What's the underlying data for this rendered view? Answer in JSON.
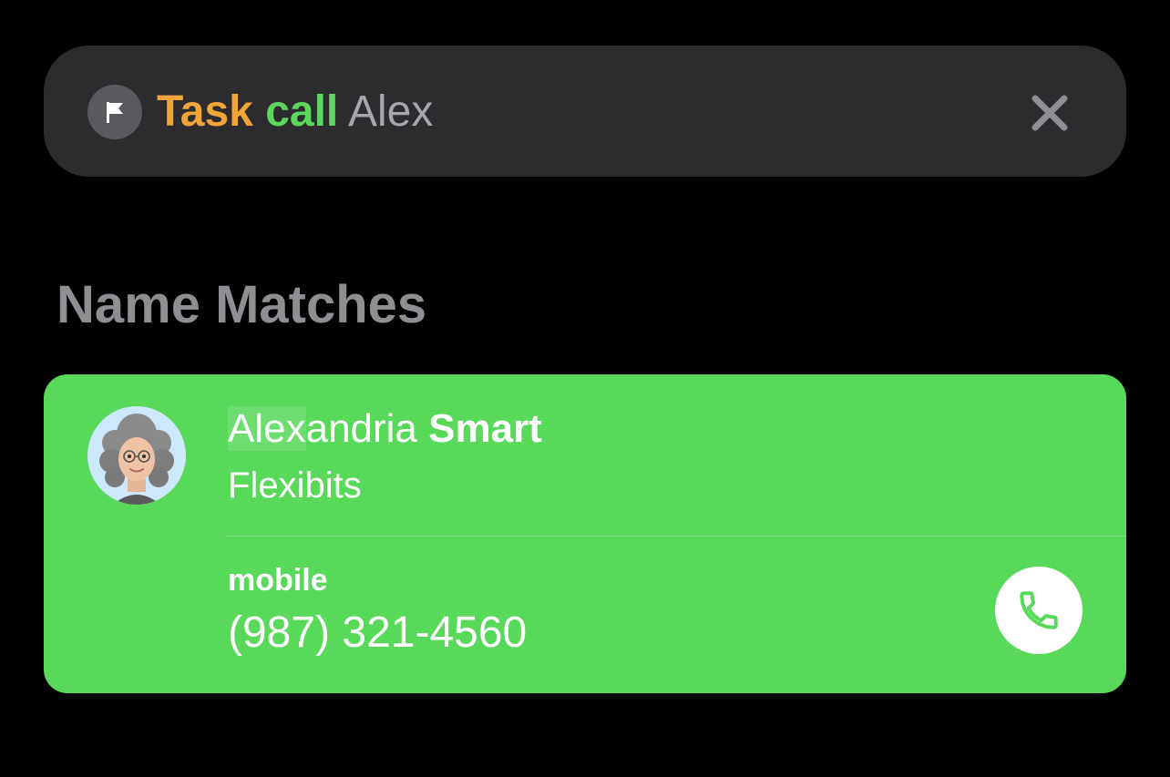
{
  "search": {
    "icon": "flag-icon",
    "tokens": {
      "task": "Task",
      "call": "call",
      "arg": "Alex"
    },
    "clear_icon": "close-icon",
    "colors": {
      "task": "#f0a53a",
      "call": "#5cd65c",
      "arg": "#a6a6ab",
      "bar": "#2c2c2e"
    }
  },
  "section": {
    "heading": "Name Matches"
  },
  "contact": {
    "avatar": "memoji-avatar",
    "first_name_match": "Alex",
    "first_name_rest": "andria",
    "last_name": "Smart",
    "company": "Flexibits",
    "phone_label": "mobile",
    "phone_number": "(987) 321-4560",
    "call_icon": "phone-icon",
    "card_color": "#58d95a"
  }
}
